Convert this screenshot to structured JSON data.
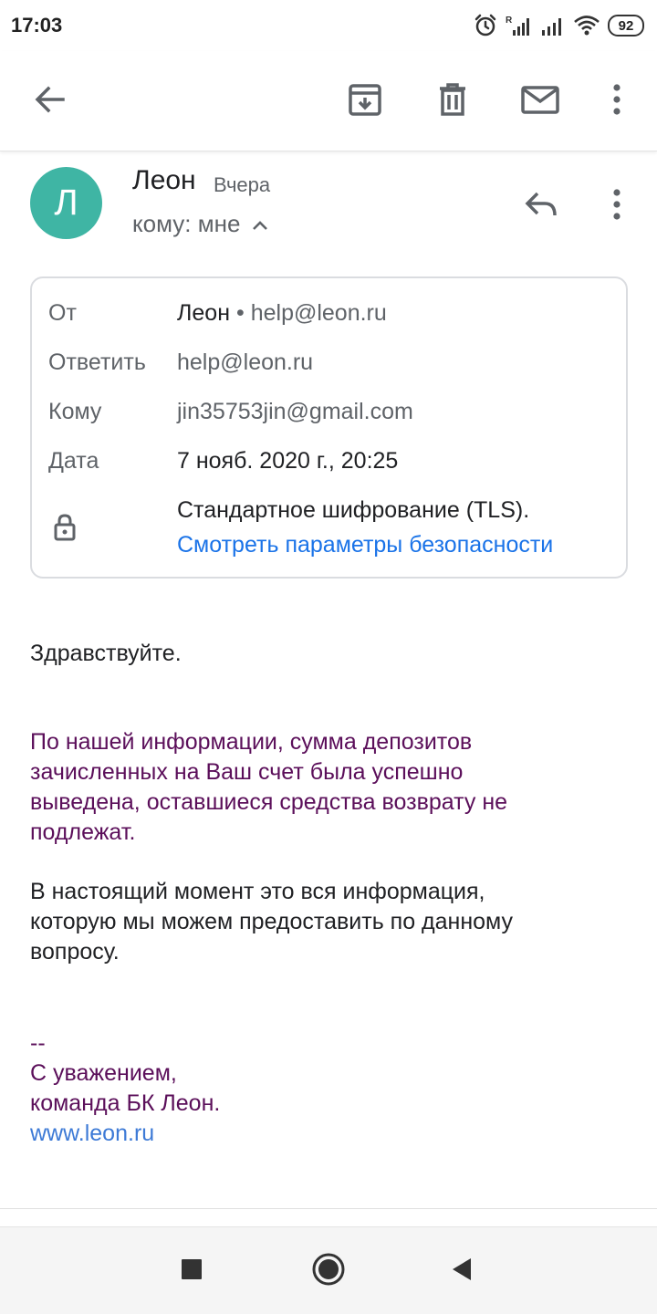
{
  "status_bar": {
    "time": "17:03",
    "battery": "92",
    "icons": [
      "alarm-icon",
      "signal-roaming-icon",
      "signal-icon",
      "wifi-icon",
      "battery-icon"
    ]
  },
  "toolbar": {
    "icons": [
      "back-arrow-icon",
      "archive-icon",
      "delete-icon",
      "mark-unread-icon",
      "more-vert-icon"
    ]
  },
  "email": {
    "avatar_letter": "Л",
    "avatar_color": "#3fb5a4",
    "sender_name": "Леон",
    "time": "Вчера",
    "recipient_summary": "кому: мне"
  },
  "details": {
    "from_label": "От",
    "from_name": "Леон",
    "from_separator": "•",
    "from_email": "help@leon.ru",
    "reply_label": "Ответить",
    "reply_value": "help@leon.ru",
    "to_label": "Кому",
    "to_value": "jin35753jin@gmail.com",
    "date_label": "Дата",
    "date_value": "7 нояб. 2020 г., 20:25",
    "encryption": "Стандартное шифрование (TLS).",
    "security_link": "Смотреть параметры безопасности"
  },
  "body": {
    "greeting": "Здравствуйте.",
    "paragraph1": [
      "По нашей информации, сумма депозитов",
      "зачисленных на Ваш счет была успешно",
      "выведена, оставшиеся средства возврату не",
      "подлежат."
    ],
    "paragraph2": [
      "В настоящий момент это вся информация,",
      "которую мы можем предоставить по данному",
      "вопросу."
    ],
    "signature_dash": "--",
    "signature_line1": "С уважением,",
    "signature_line2": "команда БК Леон.",
    "website": "www.leon.ru"
  },
  "colors": {
    "body_purple": "#5b0f5a",
    "link_blue": "#1a73e8"
  }
}
